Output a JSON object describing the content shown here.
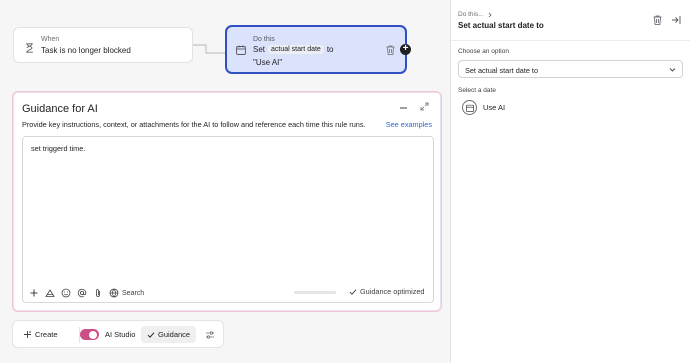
{
  "workflow": {
    "when_node": {
      "small_label": "When",
      "main_label": "Task is no longer blocked"
    },
    "do_node": {
      "small_label": "Do this",
      "set_word": "Set",
      "field_chip": "actual start date",
      "to_word": "to",
      "value_line": "\"Use AI\""
    }
  },
  "guidance": {
    "title": "Guidance for AI",
    "description": "Provide key instructions, context, or attachments for the AI to follow and reference each time this rule runs.",
    "examples_link": "See examples",
    "editor_text": "set triggerd time.",
    "search_label": "Search",
    "progress_fraction": 0.0,
    "status": "Guidance optimized"
  },
  "bottom_bar": {
    "create_label": "Create",
    "ai_studio_label": "AI Studio",
    "ai_studio_enabled": true,
    "guidance_label": "Guidance",
    "toggle_color": "#cd4d86"
  },
  "panel": {
    "breadcrumb": "Do this...",
    "title": "Set actual start date to",
    "choose_label": "Choose an option",
    "selected_option": "Set actual start date to",
    "date_label": "Select a date",
    "date_option": "Use AI"
  },
  "colors": {
    "accent": "#2f4fc2",
    "node_fill": "#dbe2fb",
    "link": "#2a66d9"
  }
}
